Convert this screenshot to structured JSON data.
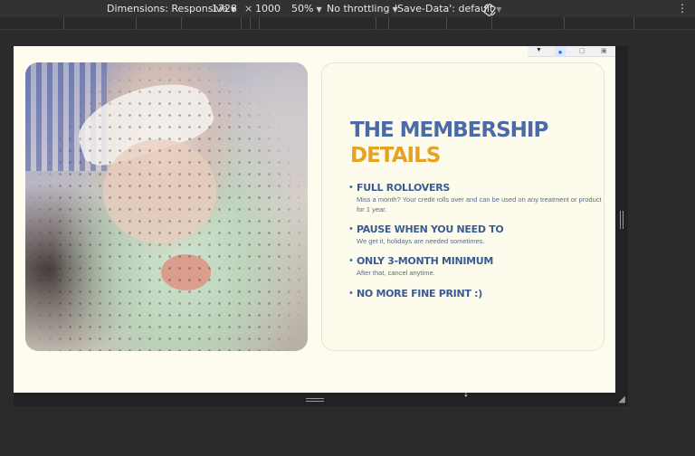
{
  "devtools": {
    "dimensions_label": "Dimensions: Responsive",
    "width_value": "1728",
    "times": "×",
    "height_value": "1000",
    "zoom": "50%",
    "throttling": "No throttling",
    "save_data": "'Save-Data': default",
    "icons": {
      "caret": "▼",
      "rotate": "rotate-icon",
      "more": "⋮",
      "resize": "resize-corner-icon",
      "cursor": "↕"
    }
  },
  "page": {
    "title_line1": "THE MEMBERSHIP",
    "title_line2": "DETAILS",
    "items": [
      {
        "bullet": "•",
        "heading": "FULL ROLLOVERS",
        "description": "Miss a month? Your credit rolls over and can be used on any treatment or product for 1 year."
      },
      {
        "bullet": "•",
        "heading": "PAUSE WHEN YOU NEED TO",
        "description": "We get it, holidays are needed sometimes."
      },
      {
        "bullet": "•",
        "heading": "ONLY 3-MONTH MINIMUM",
        "description": "After that, cancel anytime."
      },
      {
        "bullet": "•",
        "heading": "NO MORE FINE PRINT :)",
        "description": ""
      }
    ],
    "colors": {
      "title_blue": "#4c6aa8",
      "title_gold": "#e5a321",
      "background": "#fdfcee"
    }
  }
}
